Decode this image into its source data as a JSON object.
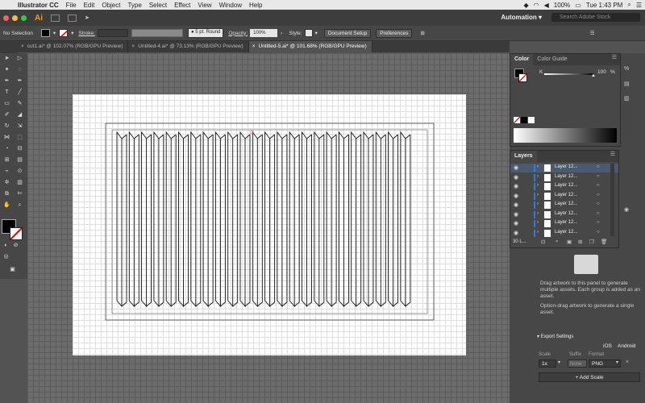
{
  "menubar": {
    "app_name": "Illustrator CC",
    "items": [
      "File",
      "Edit",
      "Object",
      "Type",
      "Select",
      "Effect",
      "View",
      "Window",
      "Help"
    ],
    "right_status": "100%",
    "clock": "Tue 1:43 PM"
  },
  "appbar": {
    "logo": "Ai",
    "workspace": "Automation ▾",
    "search_placeholder": "Search Adobe Stock"
  },
  "control_bar": {
    "selection": "No Selection",
    "stroke_label": "Stroke:",
    "brush": "5 pt. Round",
    "opacity_label": "Opacity:",
    "opacity_value": "100%",
    "style_label": "Style:",
    "document_setup": "Document Setup",
    "preferences": "Preferences"
  },
  "tabs": [
    {
      "label": "cut1.ai* @ 102.07% (RGB/GPU Preview)"
    },
    {
      "label": "Untitled-4.ai* @ 73.13% (RGB/GPU Preview)"
    },
    {
      "label": "Untitled-5.ai* @ 101.68% (RGB/GPU Preview)"
    }
  ],
  "color_panel": {
    "tab_color": "Color",
    "tab_guide": "Color Guide",
    "channel": "K",
    "value": "100",
    "unit": "%"
  },
  "layers_panel": {
    "title": "Layers",
    "rows": [
      "Layer 12...",
      "Layer 12...",
      "Layer 12...",
      "Layer 12...",
      "Layer 12...",
      "Layer 12...",
      "Layer 12...",
      "Layer 12..."
    ],
    "count": "30 L..."
  },
  "assets_panel": {
    "instructions": "Drag artwork to this panel to generate multiple assets. Each group is added as an asset.",
    "option_drag": "Option-drag artwork to generate a single asset.",
    "export_settings": "Export Settings",
    "ios": "iOS",
    "android": "Android",
    "scale_label": "Scale",
    "suffix_label": "Suffix",
    "format_label": "Format",
    "scale_value": "1x",
    "suffix_placeholder": "None",
    "format_value": "PNG",
    "add_scale": "+ Add Scale"
  },
  "colors": {
    "accent": "#ff9a00",
    "canvas": "#6c6c6c",
    "panel": "#474747"
  }
}
